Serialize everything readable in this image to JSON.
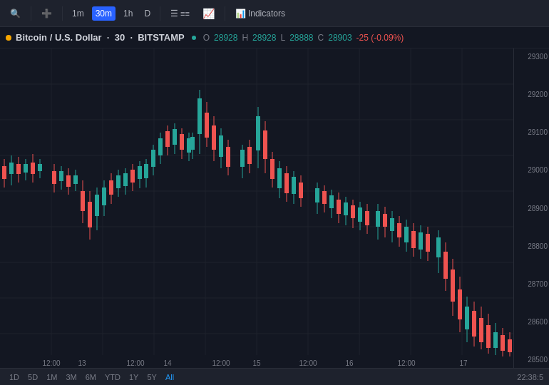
{
  "toolbar": {
    "symbol": "BTC/USD",
    "timeframes": [
      "1m",
      "30m",
      "1h",
      "D"
    ],
    "active_timeframe": "30m",
    "buttons": [
      "compare",
      "indicators"
    ],
    "indicators_label": "Indicators",
    "chart_type": "candlestick"
  },
  "symbol_bar": {
    "name": "Bitcoin / U.S. Dollar",
    "interval": "30",
    "exchange": "BITSTAMP",
    "open_label": "O",
    "high_label": "H",
    "low_label": "L",
    "close_label": "C",
    "open_value": "28928",
    "high_value": "28928",
    "low_value": "28888",
    "close_value": "28903",
    "change": "-25",
    "change_pct": "-0.09%"
  },
  "price_axis": {
    "levels": [
      "29300",
      "29200",
      "29100",
      "29000",
      "28900",
      "28800",
      "28700",
      "28600",
      "28500"
    ]
  },
  "date_axis": {
    "labels": [
      "12",
      "13",
      "12:00",
      "14",
      "12:00",
      "15",
      "12:00",
      "16",
      "12:00",
      "17"
    ]
  },
  "period_buttons": [
    "1D",
    "5D",
    "1M",
    "3M",
    "6M",
    "YTD",
    "1Y",
    "5Y",
    "All"
  ],
  "active_period": "All",
  "timestamp": "22:38:5",
  "colors": {
    "bull": "#26a69a",
    "bear": "#ef5350",
    "background": "#131722",
    "grid": "#1e222d",
    "text": "#d1d4dc",
    "muted": "#787b86",
    "accent": "#2962ff"
  }
}
